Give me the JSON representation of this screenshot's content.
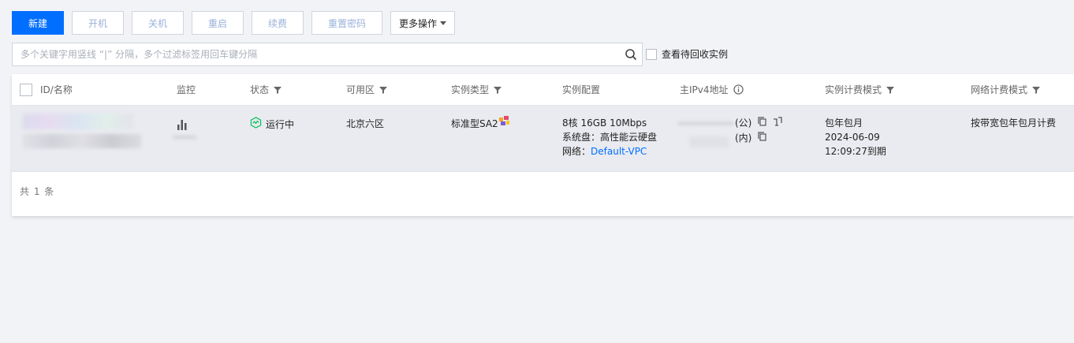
{
  "toolbar": {
    "create": "新建",
    "start": "开机",
    "stop": "关机",
    "restart": "重启",
    "renew": "续费",
    "reset_password": "重置密码",
    "more": "更多操作"
  },
  "search": {
    "placeholder": "多个关键字用竖线 “|” 分隔，多个过滤标签用回车键分隔"
  },
  "recycle_label": "查看待回收实例",
  "table": {
    "headers": {
      "id_name": "ID/名称",
      "monitor": "监控",
      "status": "状态",
      "zone": "可用区",
      "instance_type": "实例类型",
      "config": "实例配置",
      "ipv4": "主IPv4地址",
      "billing": "实例计费模式",
      "network_billing": "网络计费模式"
    },
    "row": {
      "status": "运行中",
      "zone": "北京六区",
      "instance_type": "标准型SA2",
      "config_spec": "8核 16GB 10Mbps",
      "config_disk": "系统盘：高性能云硬盘",
      "config_net_label": "网络：",
      "config_net_value": "Default-VPC",
      "ip_public_suffix": "(公)",
      "ip_private_suffix": "(内)",
      "billing_mode": "包年包月",
      "billing_date": "2024-06-09",
      "billing_expire": "12:09:27到期",
      "network_billing": "按带宽包年包月计费"
    },
    "footer": "共 1 条"
  },
  "colors": {
    "primary": "#006eff",
    "running": "#0abf5b"
  }
}
